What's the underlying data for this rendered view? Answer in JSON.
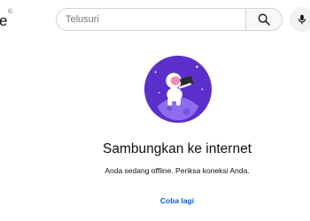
{
  "header": {
    "logo_fragment": "e",
    "logo_region_mark": "©",
    "search": {
      "placeholder": "Telusuri",
      "value": ""
    }
  },
  "icons": {
    "search": "search-icon",
    "mic": "microphone-icon",
    "illustration": "astronaut-on-planet-illustration"
  },
  "offline": {
    "title": "Sambungkan ke internet",
    "message": "Anda sedang offline. Periksa koneksi Anda.",
    "retry_label": "Coba lagi"
  },
  "colors": {
    "accent_blue": "#065fd4",
    "illustration_purple": "#5b2fc9",
    "planet_purple": "#8e6cf0"
  }
}
